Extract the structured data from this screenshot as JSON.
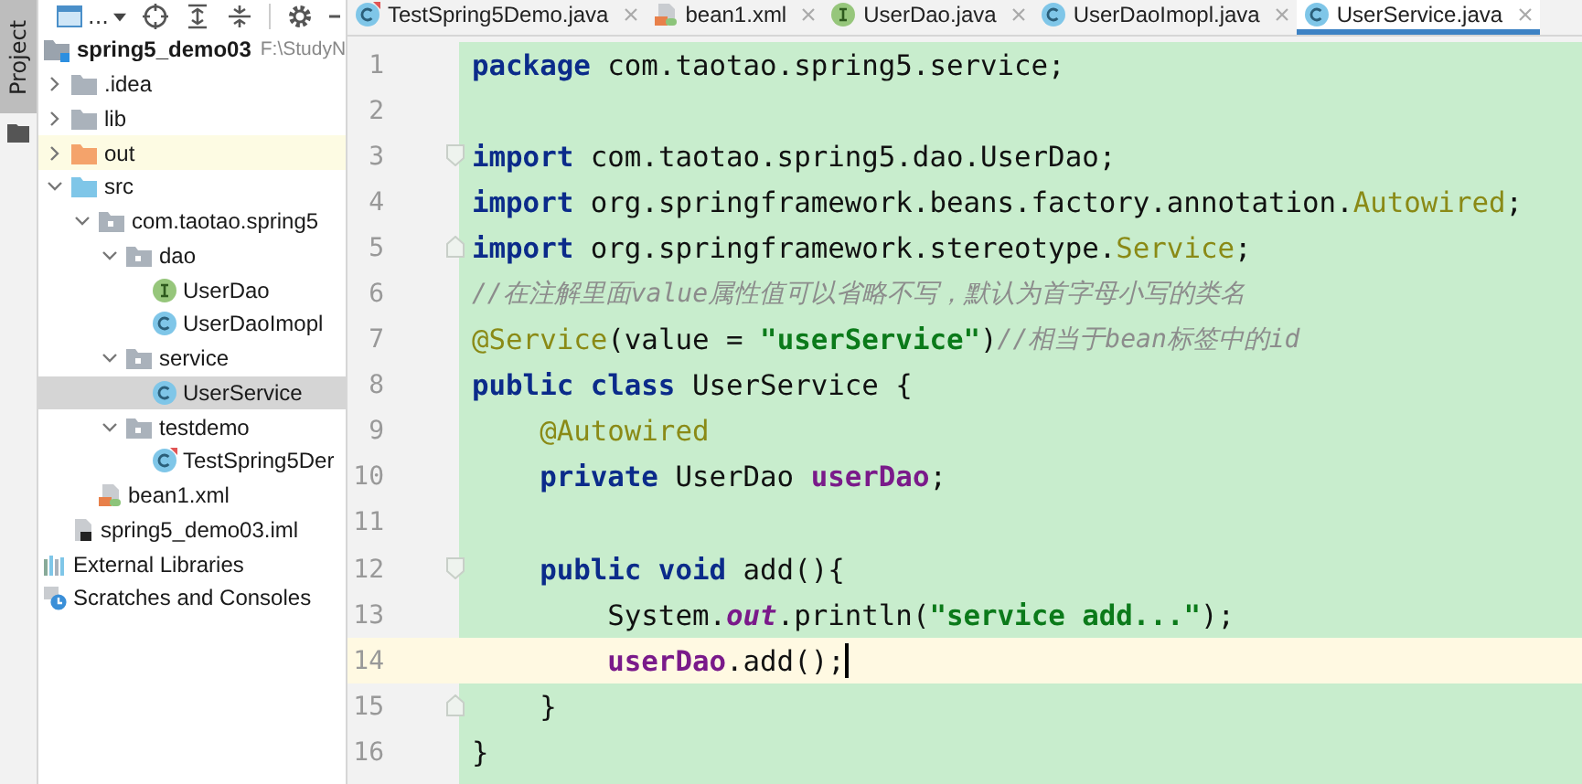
{
  "side_stripe": {
    "tab": "Project",
    "selected": true
  },
  "project_toolbar": {
    "view_label": "..."
  },
  "tree": [
    {
      "label": "spring5_demo03",
      "path": "F:\\StudyN",
      "kind": "module",
      "selected": false,
      "children": [
        {
          "label": ".idea",
          "kind": "folder",
          "expanded": false,
          "selected": false
        },
        {
          "label": "lib",
          "kind": "folder",
          "expanded": false,
          "selected": false
        },
        {
          "label": "out",
          "kind": "excluded",
          "expanded": false,
          "selected": false
        },
        {
          "label": "src",
          "kind": "source",
          "expanded": true,
          "selected": false,
          "children": [
            {
              "label": "com.taotao.spring5",
              "kind": "package",
              "expanded": true,
              "selected": false,
              "children": [
                {
                  "label": "dao",
                  "kind": "package",
                  "expanded": true,
                  "selected": false,
                  "children": [
                    {
                      "label": "UserDao",
                      "kind": "interface",
                      "selected": false
                    },
                    {
                      "label": "UserDaoImopl",
                      "kind": "class",
                      "selected": false
                    }
                  ]
                },
                {
                  "label": "service",
                  "kind": "package",
                  "expanded": true,
                  "selected": false,
                  "children": [
                    {
                      "label": "UserService",
                      "kind": "class",
                      "selected": true
                    }
                  ]
                },
                {
                  "label": "testdemo",
                  "kind": "package",
                  "expanded": true,
                  "selected": false,
                  "children": [
                    {
                      "label": "TestSpring5Der",
                      "kind": "testclass",
                      "selected": false
                    }
                  ]
                }
              ]
            },
            {
              "label": "bean1.xml",
              "kind": "xml",
              "selected": false
            }
          ]
        },
        {
          "label": "spring5_demo03.iml",
          "kind": "iml",
          "selected": false
        }
      ]
    },
    {
      "label": "External Libraries",
      "kind": "libraries",
      "selected": false
    },
    {
      "label": "Scratches and Consoles",
      "kind": "scratches",
      "selected": false
    }
  ],
  "tabs": [
    {
      "label": "TestSpring5Demo.java",
      "kind": "testclass",
      "selected": false
    },
    {
      "label": "bean1.xml",
      "kind": "xml",
      "selected": false
    },
    {
      "label": "UserDao.java",
      "kind": "interface",
      "selected": false
    },
    {
      "label": "UserDaoImopl.java",
      "kind": "class",
      "selected": false
    },
    {
      "label": "UserService.java",
      "kind": "class",
      "selected": true
    }
  ],
  "editor": {
    "lines": [
      {
        "number": "1",
        "current": false,
        "tokens": [
          {
            "kind": "keyword",
            "text": "package"
          },
          {
            "kind": "plain",
            "text": " com.taotao.spring5.service;"
          }
        ]
      },
      {
        "number": "2",
        "current": false
      },
      {
        "number": "3",
        "current": false,
        "fold_start": true,
        "tokens": [
          {
            "kind": "keyword",
            "text": "import"
          },
          {
            "kind": "plain",
            "text": " com.taotao.spring5.dao.UserDao;"
          }
        ]
      },
      {
        "number": "4",
        "current": false,
        "tokens": [
          {
            "kind": "keyword",
            "text": "import"
          },
          {
            "kind": "plain",
            "text": " org.springframework.beans.factory.annotation."
          },
          {
            "kind": "annotation",
            "text": "Autowired"
          },
          {
            "kind": "plain",
            "text": ";"
          }
        ]
      },
      {
        "number": "5",
        "current": false,
        "fold_end": true,
        "tokens": [
          {
            "kind": "keyword",
            "text": "import"
          },
          {
            "kind": "plain",
            "text": " org.springframework.stereotype."
          },
          {
            "kind": "annotation",
            "text": "Service"
          },
          {
            "kind": "plain",
            "text": ";"
          }
        ]
      },
      {
        "number": "6",
        "current": false,
        "tokens": [
          {
            "kind": "comment",
            "text": "//在注解里面value属性值可以省略不写，默认为首字母小写的类名"
          }
        ]
      },
      {
        "number": "7",
        "current": false,
        "tokens": [
          {
            "kind": "annotation",
            "text": "@Service"
          },
          {
            "kind": "plain",
            "text": "(value = "
          },
          {
            "kind": "string",
            "text": "\"userService\""
          },
          {
            "kind": "plain",
            "text": ")"
          },
          {
            "kind": "comment",
            "text": "//相当于bean标签中的id"
          }
        ]
      },
      {
        "number": "8",
        "current": false,
        "tokens": [
          {
            "kind": "keyword",
            "text": "public class"
          },
          {
            "kind": "plain",
            "text": " UserService {"
          }
        ]
      },
      {
        "number": "9",
        "current": false,
        "tokens": [
          {
            "kind": "annotation",
            "text": "    @Autowired"
          }
        ]
      },
      {
        "number": "10",
        "current": false,
        "tokens": [
          {
            "kind": "keyword",
            "text": "    private"
          },
          {
            "kind": "plain",
            "text": " UserDao "
          },
          {
            "kind": "field",
            "text": "userDao"
          },
          {
            "kind": "plain",
            "text": ";"
          }
        ]
      },
      {
        "number": "11",
        "current": false
      },
      {
        "number": "12",
        "current": false,
        "fold_start": true,
        "tokens": [
          {
            "kind": "keyword",
            "text": "    public void"
          },
          {
            "kind": "plain",
            "text": " add(){"
          }
        ]
      },
      {
        "number": "13",
        "current": false,
        "tokens": [
          {
            "kind": "plain",
            "text": "        System."
          },
          {
            "kind": "static",
            "text": "out"
          },
          {
            "kind": "plain",
            "text": ".println("
          },
          {
            "kind": "string",
            "text": "\"service add...\""
          },
          {
            "kind": "plain",
            "text": ");"
          }
        ]
      },
      {
        "number": "14",
        "current": true,
        "tokens": [
          {
            "kind": "field",
            "text": "        userDao"
          },
          {
            "kind": "plain",
            "text": ".add();"
          }
        ]
      },
      {
        "number": "15",
        "current": false,
        "fold_end": true,
        "tokens": [
          {
            "kind": "plain",
            "text": "    }"
          }
        ]
      },
      {
        "number": "16",
        "current": false,
        "tokens": [
          {
            "kind": "plain",
            "text": "}"
          }
        ]
      }
    ]
  }
}
